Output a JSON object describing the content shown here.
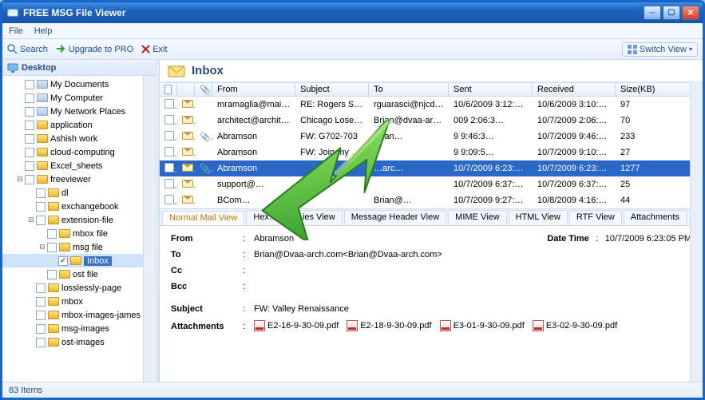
{
  "window": {
    "title": "FREE MSG File Viewer"
  },
  "menu": {
    "file": "File",
    "help": "Help"
  },
  "toolbar": {
    "search": "Search",
    "upgrade": "Upgrade to PRO",
    "exit": "Exit",
    "switch_view": "Switch View"
  },
  "tree": {
    "root": "Desktop",
    "items": [
      {
        "indent": 1,
        "exp": "",
        "label": "My Documents",
        "sys": true
      },
      {
        "indent": 1,
        "exp": "",
        "label": "My Computer",
        "sys": true
      },
      {
        "indent": 1,
        "exp": "",
        "label": "My Network Places",
        "sys": true
      },
      {
        "indent": 1,
        "exp": "",
        "label": "application"
      },
      {
        "indent": 1,
        "exp": "",
        "label": "Ashish work"
      },
      {
        "indent": 1,
        "exp": "",
        "label": "cloud-computing"
      },
      {
        "indent": 1,
        "exp": "",
        "label": "Excel_sheets"
      },
      {
        "indent": 1,
        "exp": "-",
        "label": "freeviewer"
      },
      {
        "indent": 2,
        "exp": "",
        "label": "dl"
      },
      {
        "indent": 2,
        "exp": "",
        "label": "exchangebook"
      },
      {
        "indent": 2,
        "exp": "-",
        "label": "extension-file"
      },
      {
        "indent": 3,
        "exp": "",
        "label": "mbox file"
      },
      {
        "indent": 3,
        "exp": "-",
        "label": "msg file"
      },
      {
        "indent": 4,
        "exp": "",
        "label": "Inbox",
        "checked": true,
        "selected": true
      },
      {
        "indent": 3,
        "exp": "",
        "label": "ost file"
      },
      {
        "indent": 2,
        "exp": "",
        "label": "losslessly-page"
      },
      {
        "indent": 2,
        "exp": "",
        "label": "mbox"
      },
      {
        "indent": 2,
        "exp": "",
        "label": "mbox-images-james"
      },
      {
        "indent": 2,
        "exp": "",
        "label": "msg-images"
      },
      {
        "indent": 2,
        "exp": "",
        "label": "ost-images"
      }
    ]
  },
  "content": {
    "title": "Inbox"
  },
  "columns": {
    "from": "From",
    "subject": "Subject",
    "to": "To",
    "sent": "Sent",
    "received": "Received",
    "size": "Size(KB)"
  },
  "mails": [
    {
      "att": false,
      "from": "mramaglia@mai…",
      "subject": "RE: Rogers Stor…",
      "to": "rguarasci@njcd…",
      "sent": "10/6/2009 3:12:4…",
      "received": "10/6/2009 3:10:1…",
      "size": "97"
    },
    {
      "att": false,
      "from": "architect@archit…",
      "subject": "Chicago Loses 2…",
      "to": "Brian@dvaa-arc…",
      "sent": "009 2:06:3…",
      "received": "10/7/2009 2:06:3…",
      "size": "70"
    },
    {
      "att": true,
      "from": "Abramson",
      "subject": "FW: G702-703",
      "to": "Brian…",
      "sent": "9 9:46:3…",
      "received": "10/7/2009 9:46:5…",
      "size": "233"
    },
    {
      "att": false,
      "from": "Abramson",
      "subject": "FW: Join my p…",
      "to": "",
      "sent": "9 9:09:5…",
      "received": "10/7/2009 9:10:0…",
      "size": "27"
    },
    {
      "att": true,
      "from": "Abramson",
      "subject": "",
      "to": "…arc…",
      "sent": "10/7/2009 6:23:0…",
      "received": "10/7/2009 6:23:0…",
      "size": "1277",
      "selected": true
    },
    {
      "att": false,
      "from": "support@…",
      "subject": "",
      "to": "",
      "sent": "10/7/2009 6:37:4…",
      "received": "10/7/2009 6:37:5…",
      "size": "25"
    },
    {
      "att": false,
      "from": "BCom…",
      "subject": "",
      "to": "Brian@…",
      "sent": "10/7/2009 9:27:3…",
      "received": "10/8/2009 4:16:1…",
      "size": "44"
    }
  ],
  "tabs": {
    "normal": "Normal Mail View",
    "hex": "Hex…",
    "ies": "…ies View",
    "header": "Message Header View",
    "mime": "MIME View",
    "html": "HTML View",
    "rtf": "RTF View",
    "att": "Attachments"
  },
  "detail": {
    "from_l": "From",
    "from_v": "Abramson",
    "dt_l": "Date Time",
    "dt_v": "10/7/2009 6:23:05 PM",
    "to_l": "To",
    "to_v": "Brian@Dvaa-arch.com<Brian@Dvaa-arch.com>",
    "cc_l": "Cc",
    "cc_v": "",
    "bcc_l": "Bcc",
    "bcc_v": "",
    "subj_l": "Subject",
    "subj_v": "FW: Valley Renaissance",
    "att_l": "Attachments",
    "attachments": [
      "E2-16-9-30-09.pdf",
      "E2-18-9-30-09.pdf",
      "E3-01-9-30-09.pdf",
      "E3-02-9-30-09.pdf"
    ]
  },
  "status": {
    "items": "83 Items"
  }
}
